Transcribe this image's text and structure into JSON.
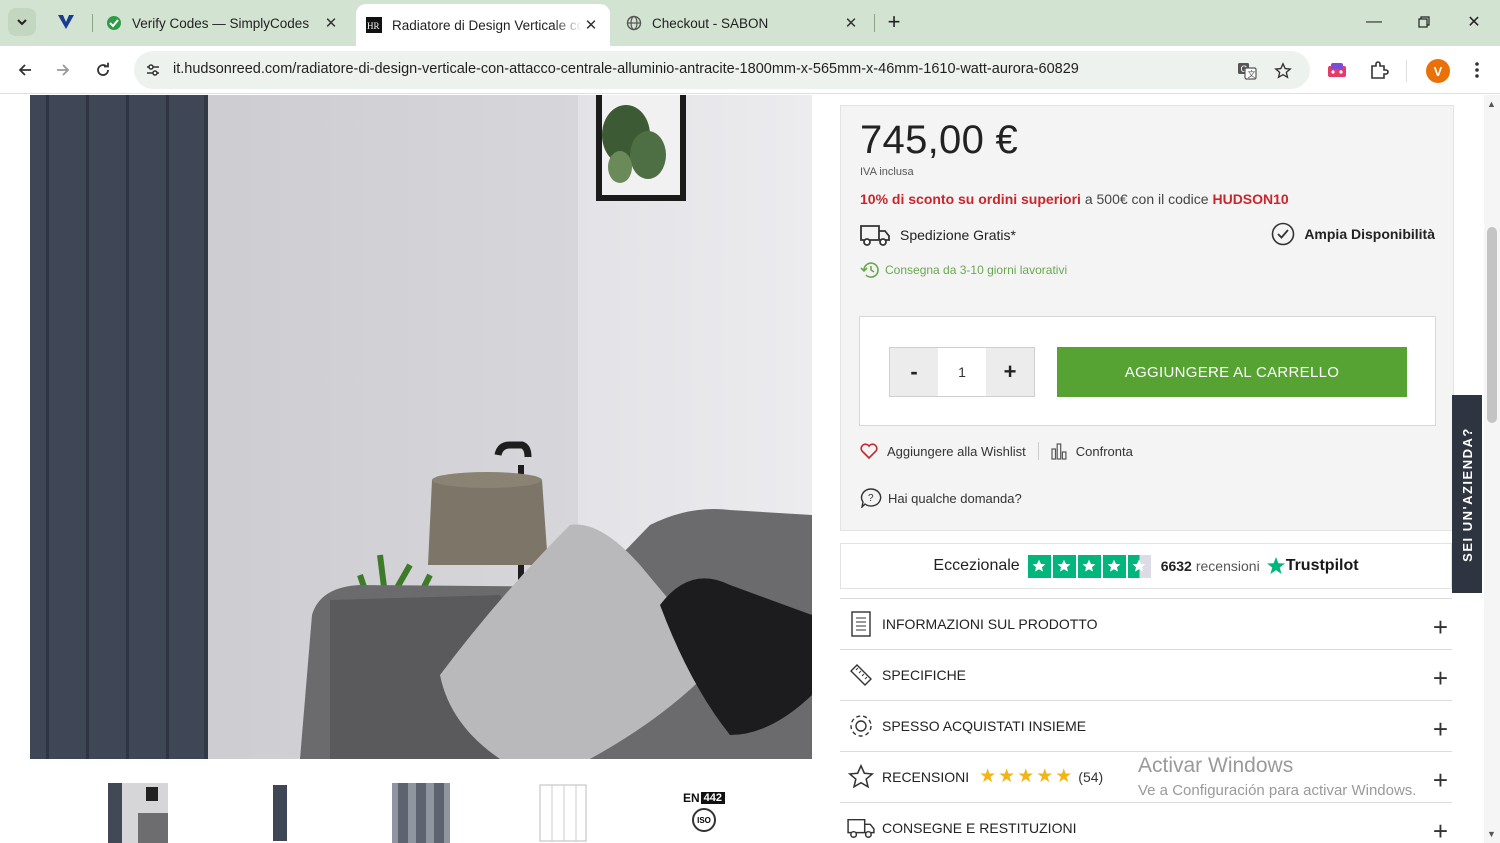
{
  "browser": {
    "tabs": [
      {
        "title": "Verify Codes — SimplyCodes",
        "active": false
      },
      {
        "title": "Radiatore di Design Verticale co",
        "active": true
      },
      {
        "title": "Checkout - SABON",
        "active": false
      }
    ],
    "url": "it.hudsonreed.com/radiatore-di-design-verticale-con-attacco-centrale-alluminio-antracite-1800mm-x-565mm-x-46mm-1610-watt-aurora-60829",
    "profile_initial": "V"
  },
  "product": {
    "price": "745,00 €",
    "vat": "IVA inclusa",
    "promo_bold": "10% di sconto su ordini superiori",
    "promo_mid": " a 500€ con il codice ",
    "promo_code": "HUDSON10",
    "shipping": "Spedizione Gratis*",
    "availability": "Ampia Disponibilità",
    "delivery": "Consegna da 3-10 giorni lavorativi",
    "qty_minus": "-",
    "qty_value": "1",
    "qty_plus": "+",
    "add_to_cart": "AGGIUNGERE AL CARRELLO",
    "wishlist": "Aggiungere alla Wishlist",
    "compare": "Confronta",
    "question": "Hai qualche domanda?"
  },
  "trustpilot": {
    "label": "Eccezionale",
    "count": "6632",
    "reviews_word": "recensioni",
    "brand": "Trustpilot"
  },
  "accordion": [
    {
      "label": "INFORMAZIONI SUL PRODOTTO"
    },
    {
      "label": "SPECIFICHE"
    },
    {
      "label": "SPESSO ACQUISTATI INSIEME"
    },
    {
      "label": "RECENSIONI",
      "stars": "★★★★★",
      "count": "(54)"
    },
    {
      "label": "CONSEGNE E RESTITUZIONI"
    }
  ],
  "side_tab": "SEI UN'AZIENDA?",
  "watermark": {
    "title": "Activar Windows",
    "subtitle": "Ve a Configuración para activar Windows."
  },
  "thumbnail_badge": {
    "en": "EN",
    "num": "442",
    "iso": "ISO"
  },
  "colors": {
    "cart_green": "#56a233",
    "promo_red": "#c8262d",
    "delivery_green": "#6aa84f",
    "trust_green": "#00b67a"
  }
}
